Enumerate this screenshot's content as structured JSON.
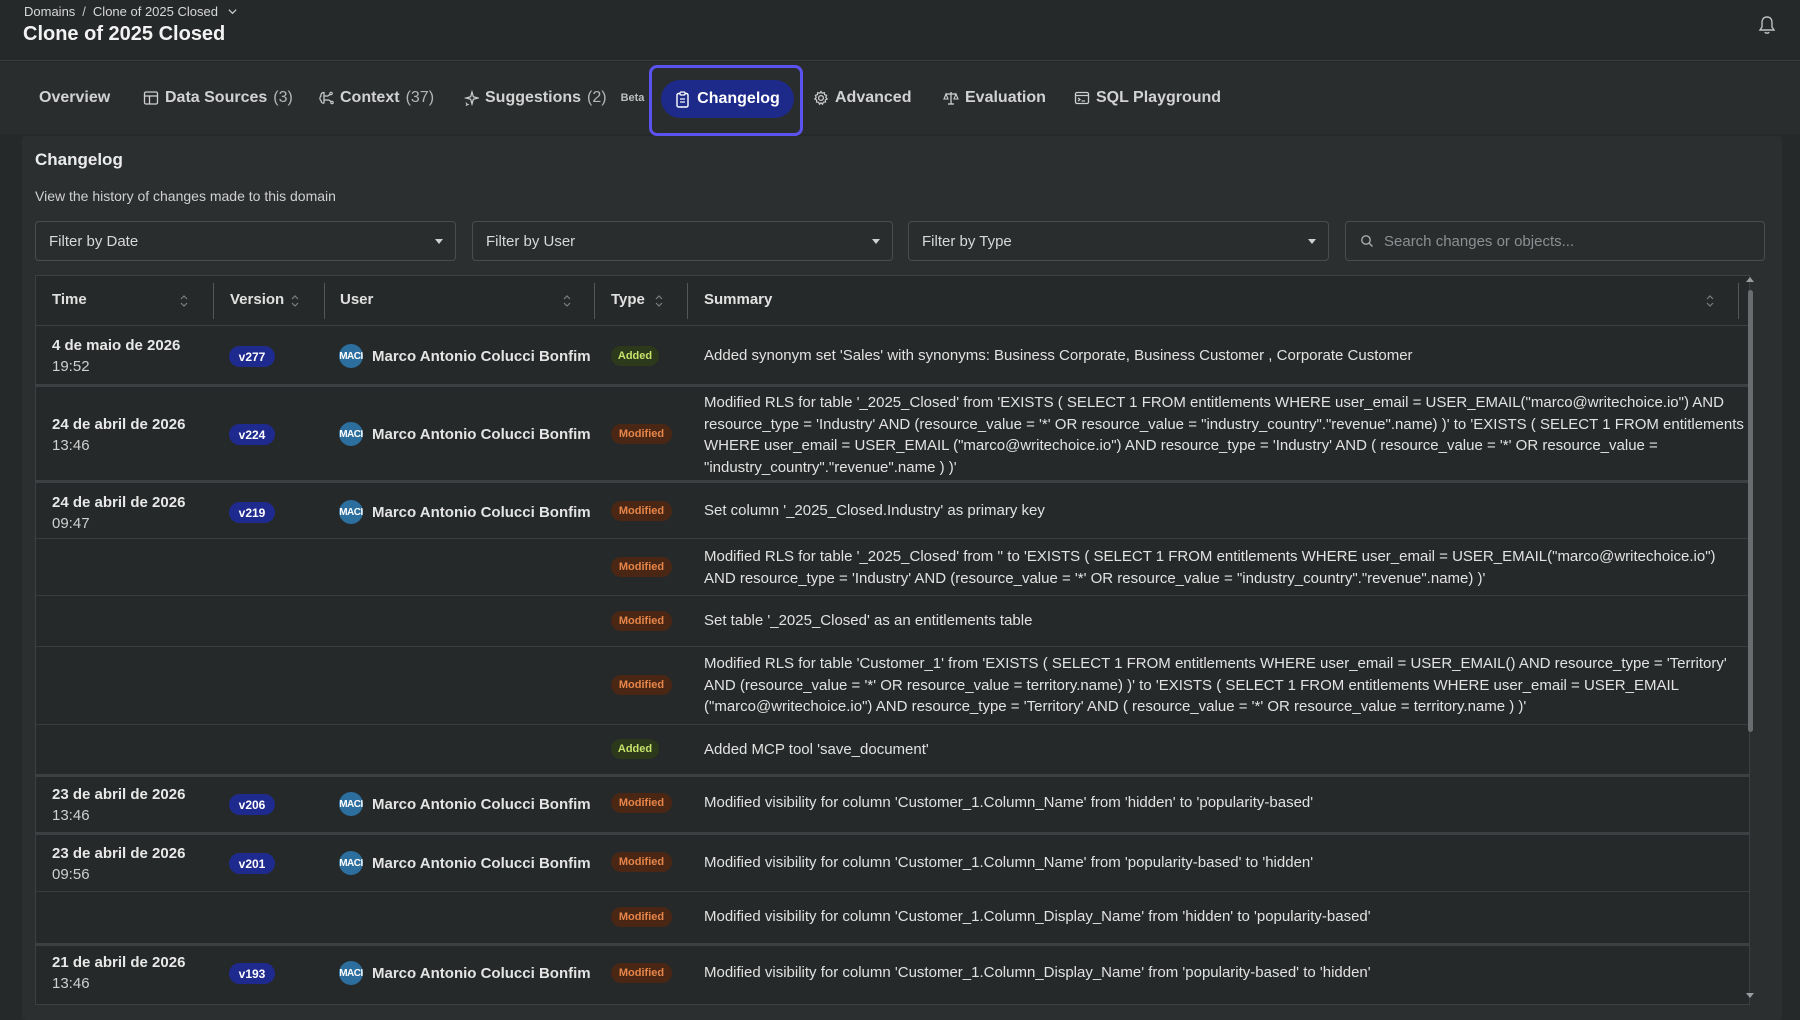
{
  "breadcrumb": {
    "root": "Domains",
    "separator": "/",
    "current": "Clone of 2025 Closed"
  },
  "page_title": "Clone of 2025 Closed",
  "tabs": {
    "overview": {
      "label": "Overview"
    },
    "data_sources": {
      "label": "Data Sources",
      "count": "(3)"
    },
    "context": {
      "label": "Context",
      "count": "(37)"
    },
    "suggestions": {
      "label": "Suggestions",
      "count": "(2)",
      "badge": "Beta"
    },
    "changelog": {
      "label": "Changelog"
    },
    "advanced": {
      "label": "Advanced"
    },
    "evaluation": {
      "label": "Evaluation"
    },
    "sql_playground": {
      "label": "SQL Playground"
    }
  },
  "changelog": {
    "title": "Changelog",
    "subtitle": "View the history of changes made to this domain"
  },
  "filters": {
    "date": "Filter by Date",
    "user": "Filter by User",
    "type": "Filter by Type",
    "search_placeholder": "Search changes or objects..."
  },
  "columns": {
    "time": "Time",
    "version": "Version",
    "user": "User",
    "type": "Type",
    "summary": "Summary"
  },
  "avatar_initials": "MACI",
  "rows": [
    {
      "date": "4 de maio de 2026",
      "time": "19:52",
      "version": "v277",
      "user": "Marco Antonio Colucci Bonfim",
      "type": "Added",
      "summary": "Added synonym set 'Sales' with synonyms: Business Corporate, Business Customer , Corporate Customer"
    },
    {
      "date": "24 de abril de 2026",
      "time": "13:46",
      "version": "v224",
      "user": "Marco Antonio Colucci Bonfim",
      "type": "Modified",
      "summary": "Modified RLS for table '_2025_Closed' from 'EXISTS ( SELECT 1 FROM entitlements WHERE user_email = USER_EMAIL(\"marco@writechoice.io\") AND resource_type = 'Industry' AND (resource_value = '*' OR resource_value = \"industry_country\".\"revenue\".name) )' to 'EXISTS ( SELECT 1 FROM entitlements WHERE user_email = USER_EMAIL (\"marco@writechoice.io\") AND resource_type = 'Industry' AND ( resource_value = '*' OR resource_value = \"industry_country\".\"revenue\".name ) )'"
    },
    {
      "date": "24 de abril de 2026",
      "time": "09:47",
      "version": "v219",
      "user": "Marco Antonio Colucci Bonfim",
      "type": "Modified",
      "summary": "Set column '_2025_Closed.Industry' as primary key"
    },
    {
      "type": "Modified",
      "summary": "Modified RLS for table '_2025_Closed' from '' to 'EXISTS ( SELECT 1 FROM entitlements WHERE user_email = USER_EMAIL(\"marco@writechoice.io\") AND resource_type = 'Industry' AND (resource_value = '*' OR resource_value = \"industry_country\".\"revenue\".name) )'"
    },
    {
      "type": "Modified",
      "summary": "Set table '_2025_Closed' as an entitlements table"
    },
    {
      "type": "Modified",
      "summary": "Modified RLS for table 'Customer_1' from 'EXISTS ( SELECT 1 FROM entitlements WHERE user_email = USER_EMAIL() AND resource_type = 'Territory' AND (resource_value = '*' OR resource_value = territory.name) )' to 'EXISTS ( SELECT 1 FROM entitlements WHERE user_email = USER_EMAIL (\"marco@writechoice.io\") AND resource_type = 'Territory' AND ( resource_value = '*' OR resource_value = territory.name ) )'"
    },
    {
      "type": "Added",
      "summary": "Added MCP tool 'save_document'"
    },
    {
      "date": "23 de abril de 2026",
      "time": "13:46",
      "version": "v206",
      "user": "Marco Antonio Colucci Bonfim",
      "type": "Modified",
      "summary": "Modified visibility for column 'Customer_1.Column_Name' from 'hidden' to 'popularity-based'"
    },
    {
      "date": "23 de abril de 2026",
      "time": "09:56",
      "version": "v201",
      "user": "Marco Antonio Colucci Bonfim",
      "type": "Modified",
      "summary": "Modified visibility for column 'Customer_1.Column_Name' from 'popularity-based' to 'hidden'"
    },
    {
      "type": "Modified",
      "summary": "Modified visibility for column 'Customer_1.Column_Display_Name' from 'hidden' to 'popularity-based'"
    },
    {
      "date": "21 de abril de 2026",
      "time": "13:46",
      "version": "v193",
      "user": "Marco Antonio Colucci Bonfim",
      "type": "Modified",
      "summary": "Modified visibility for column 'Customer_1.Column_Display_Name' from 'popularity-based' to 'hidden'"
    }
  ]
}
